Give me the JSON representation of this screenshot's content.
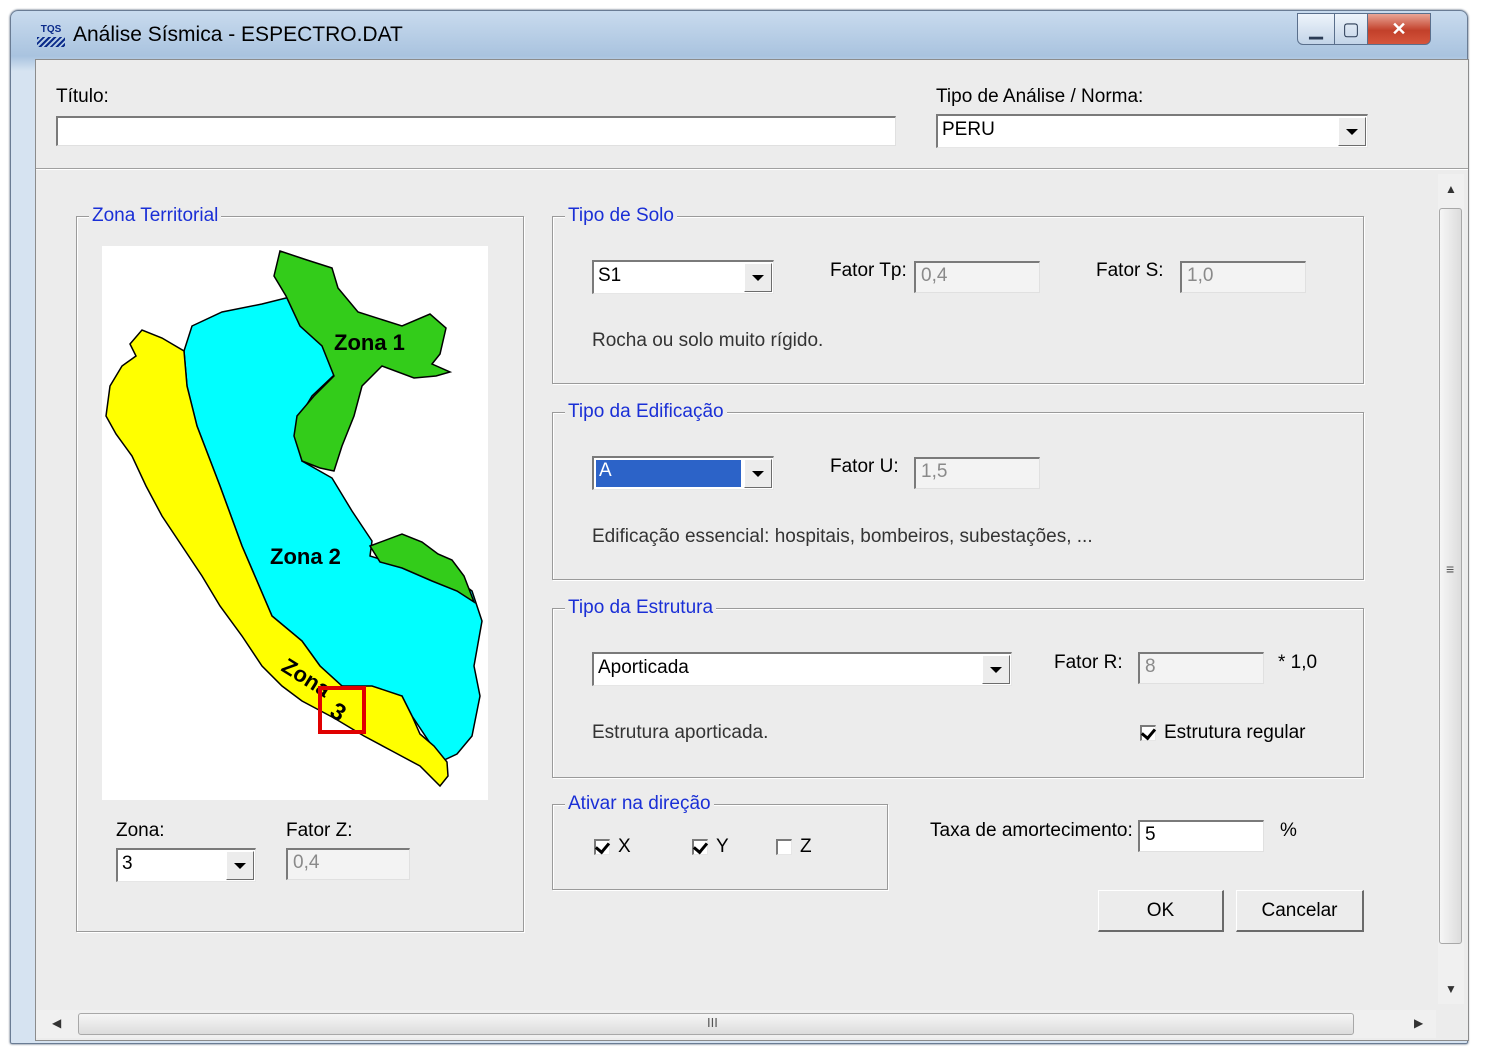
{
  "window": {
    "title": "Análise Sísmica - ESPECTRO.DAT",
    "icon_text": "TQS",
    "buttons": {
      "minimize_icon": "minimize-icon",
      "maximize_icon": "maximize-icon",
      "close_icon": "close-icon"
    }
  },
  "header": {
    "titulo_label": "Título:",
    "titulo_value": "",
    "tipo_analise_label": "Tipo de Análise / Norma:",
    "tipo_analise_value": "PERU"
  },
  "zona_territorial": {
    "legend": "Zona Territorial",
    "map_labels": {
      "zona1": "Zona 1",
      "zona2": "Zona 2",
      "zona3_a": "Zona",
      "zona3_b": "3"
    },
    "zona_label": "Zona:",
    "zona_value": "3",
    "fator_z_label": "Fator Z:",
    "fator_z_value": "0,4"
  },
  "tipo_solo": {
    "legend": "Tipo de Solo",
    "value": "S1",
    "fator_tp_label": "Fator Tp:",
    "fator_tp_value": "0,4",
    "fator_s_label": "Fator S:",
    "fator_s_value": "1,0",
    "description": "Rocha ou solo muito rígido."
  },
  "tipo_edificacao": {
    "legend": "Tipo da Edificação",
    "value": "A",
    "fator_u_label": "Fator U:",
    "fator_u_value": "1,5",
    "description": "Edificação essencial: hospitais, bombeiros, subestações, ..."
  },
  "tipo_estrutura": {
    "legend": "Tipo da Estrutura",
    "value": "Aporticada",
    "fator_r_label": "Fator R:",
    "fator_r_value": "8",
    "fator_r_suffix": "* 1,0",
    "description": "Estrutura aporticada.",
    "regular_label": "Estrutura regular",
    "regular_checked": true
  },
  "ativar_direcao": {
    "legend": "Ativar na direção",
    "x_label": "X",
    "x_checked": true,
    "y_label": "Y",
    "y_checked": true,
    "z_label": "Z",
    "z_checked": false
  },
  "amortecimento": {
    "label": "Taxa de amortecimento:",
    "value": "5",
    "unit": "%"
  },
  "actions": {
    "ok": "OK",
    "cancel": "Cancelar"
  },
  "scrollbar": {
    "grip": "≡",
    "hgrip": "III"
  },
  "colors": {
    "zona1": "#33cc1a",
    "zona2": "#00ffff",
    "zona3": "#ffff00",
    "legend": "#1a2fd6",
    "highlight": "#e00000"
  }
}
